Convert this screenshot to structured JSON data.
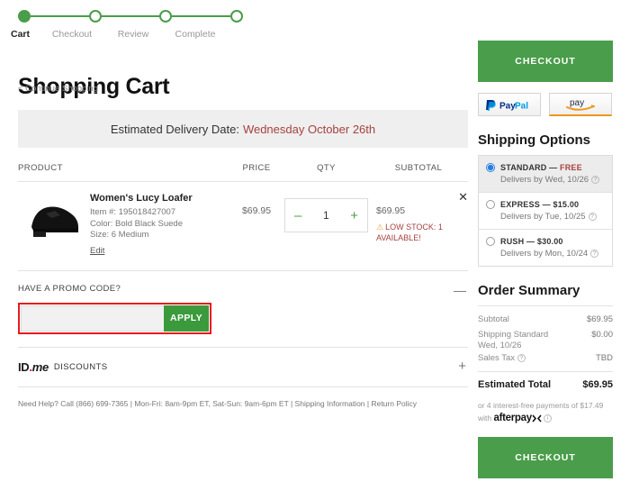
{
  "stepper": {
    "steps": [
      {
        "label": "Cart",
        "state": "active"
      },
      {
        "label": "Checkout",
        "state": "pending"
      },
      {
        "label": "Review",
        "state": "pending"
      },
      {
        "label": "Complete",
        "state": "pending"
      }
    ]
  },
  "header": {
    "title": "Shopping Cart",
    "continue_link": "< Continue Shopping"
  },
  "delivery": {
    "label": "Estimated Delivery Date:",
    "date": "Wednesday October 26th"
  },
  "table": {
    "headers": {
      "product": "PRODUCT",
      "price": "PRICE",
      "qty": "QTY",
      "subtotal": "SUBTOTAL"
    },
    "items": [
      {
        "title": "Women's Lucy Loafer",
        "item_number": "Item #: 195018427007",
        "color": "Color: Bold Black Suede",
        "size": "Size: 6 Medium",
        "edit_label": "Edit",
        "price": "$69.95",
        "qty": "1",
        "minus": "–",
        "plus": "+",
        "subtotal": "$69.95",
        "stock_warning": "LOW STOCK: 1 AVAILABLE!",
        "remove_label": "✕"
      }
    ]
  },
  "promo": {
    "label": "HAVE A PROMO CODE?",
    "input_value": "",
    "placeholder": "",
    "apply_label": "APPLY",
    "collapse_sign": "—"
  },
  "idme": {
    "brand_id": "ID",
    "brand_dot": ".",
    "brand_me": "me",
    "label": "DISCOUNTS",
    "expand_sign": "+"
  },
  "footer": {
    "help_text": "Need Help? Call (866) 699-7365  |  Mon-Fri: 8am-9pm ET, Sat-Sun: 9am-6pm ET  |  Shipping Information  |  Return Policy"
  },
  "sidebar": {
    "checkout_top_label": "CHECKOUT",
    "checkout_bottom_label": "CHECKOUT",
    "paypal_label": "PayPal",
    "amazonpay_label": "pay",
    "shipping_title": "Shipping Options",
    "shipping_options": [
      {
        "name": "STANDARD — ",
        "cost": "FREE",
        "delivers": "Delivers by Wed, 10/26",
        "selected": true
      },
      {
        "name": "EXPRESS — $15.00",
        "cost": "",
        "delivers": "Delivers by Tue, 10/25",
        "selected": false
      },
      {
        "name": "RUSH — $30.00",
        "cost": "",
        "delivers": "Delivers by Mon, 10/24",
        "selected": false
      }
    ],
    "summary_title": "Order Summary",
    "summary_rows": [
      {
        "label": "Subtotal",
        "value": "$69.95"
      },
      {
        "label": "Shipping Standard",
        "value": "$0.00"
      },
      {
        "label": "Sales Tax",
        "value": "TBD",
        "has_help": true
      }
    ],
    "shipping_date_note": "Wed, 10/26",
    "total_label": "Estimated Total",
    "total_value": "$69.95",
    "afterpay_text": "or 4 interest-free payments of $17.49",
    "afterpay_with": "with",
    "afterpay_brand": "afterpay"
  },
  "colors": {
    "brand_green": "#4a9d4a",
    "apply_green": "#3b9a3b",
    "highlight_red": "#e8191d",
    "alert_red": "#a6423f",
    "warn_orange": "#e8a33d",
    "radio_blue": "#2a7de1"
  }
}
